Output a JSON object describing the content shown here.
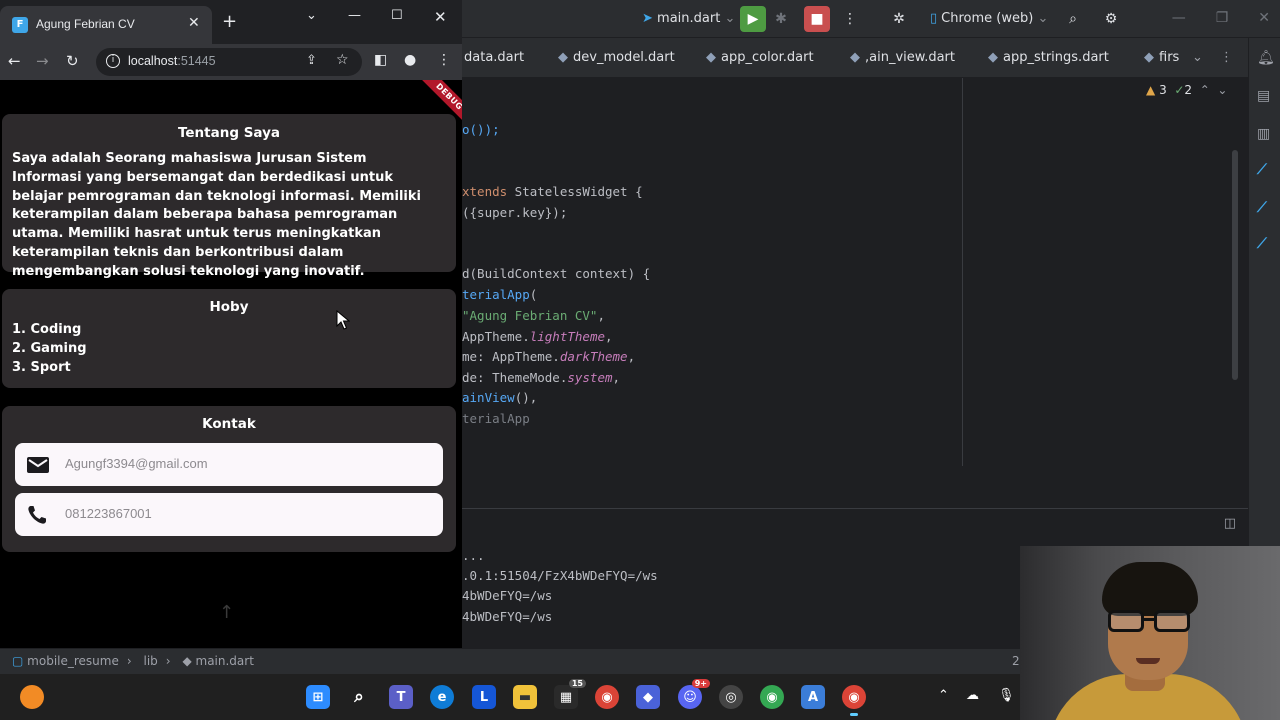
{
  "ide": {
    "run_config": "main.dart",
    "device": "Chrome (web)",
    "tabs": [
      "data.dart",
      "dev_model.dart",
      "app_color.dart",
      ",ain_view.dart",
      "app_strings.dart",
      "firs"
    ],
    "warnings": "3",
    "checks": "2",
    "code": {
      "l1": "o());",
      "l2_kw": "xtends",
      "l2_rest": " StatelessWidget {",
      "l3": "({super.key});",
      "l4": "d(BuildContext context) {",
      "l5_fn": "terialApp",
      "l5_rest": "(",
      "l6_str": "\"Agung Febrian CV\"",
      "l6_rest": ",",
      "l7_a": "AppTheme.",
      "l7_b": "lightTheme",
      "l7_c": ",",
      "l8_a": "me: AppTheme.",
      "l8_b": "darkTheme",
      "l8_c": ",",
      "l9_a": "de: ThemeMode.",
      "l9_b": "system",
      "l9_c": ",",
      "l10_fn": "ainView",
      "l10_rest": "(),",
      "l11": "terialApp"
    },
    "console": {
      "c1": "...",
      "c2": ".0.1:51504/FzX4bWDeFYQ=/ws",
      "c3": "4bWDeFYQ=/ws",
      "c4": "4bWDeFYQ=/ws"
    },
    "status": {
      "project": "mobile_resume",
      "folder": "lib",
      "file": "main.dart",
      "pos": "2"
    }
  },
  "taskbar": {
    "store_badge": "15",
    "discord_badge": "9+"
  },
  "chrome": {
    "tab_title": "Agung Febrian CV",
    "url_host": "localhost",
    "url_port": ":51445"
  },
  "app": {
    "debug_label": "DEBUG",
    "about": {
      "title": "Tentang Saya",
      "text": "Saya adalah Seorang mahasiswa Jurusan Sistem Informasi yang bersemangat dan berdedikasi untuk belajar pemrograman dan teknologi informasi. Memiliki keterampilan dalam beberapa bahasa pemrograman utama. Memiliki hasrat untuk terus meningkatkan keterampilan teknis dan berkontribusi dalam mengembangkan solusi teknologi yang inovatif."
    },
    "hobby": {
      "title": "Hoby",
      "items": [
        "1. Coding",
        "2. Gaming",
        "3. Sport"
      ]
    },
    "contact": {
      "title": "Kontak",
      "email_placeholder": "Agungf3394@gmail.com",
      "phone_placeholder": "081223867001"
    }
  }
}
